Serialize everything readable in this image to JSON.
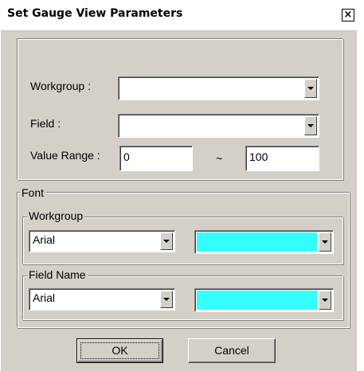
{
  "dialog": {
    "title": "Set Gauge View Parameters",
    "close_glyph": "×",
    "close_icon": "close-icon"
  },
  "params": {
    "workgroup_label": "Workgroup :",
    "workgroup_value": "",
    "field_label": "Field :",
    "field_value": "",
    "value_range_label": "Value Range :",
    "range_min": "0",
    "range_separator": "~",
    "range_max": "100"
  },
  "font": {
    "group_label": "Font",
    "workgroup": {
      "label": "Workgroup",
      "font_name": "Arial",
      "color": "#33ffff"
    },
    "field_name": {
      "label": "Field Name",
      "font_name": "Arial",
      "color": "#33ffff"
    }
  },
  "buttons": {
    "ok": "OK",
    "cancel": "Cancel"
  },
  "colors": {
    "dialog_face": "#d4d0c8",
    "swatch_cyan": "#33ffff"
  }
}
